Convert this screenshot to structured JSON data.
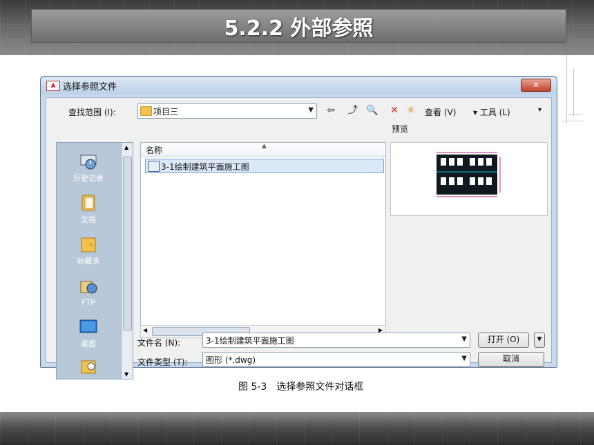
{
  "slide": {
    "title": "5.2.2 外部参照",
    "caption": "图 5-3　选择参照文件对话框"
  },
  "dialog": {
    "title": "选择参照文件",
    "app_icon_text": "A",
    "close_label": "✕",
    "look_in_label": "查找范围 (I):",
    "look_in_value": "项目三",
    "toolbar": {
      "back_icon": "⇦",
      "up_folder_icon": "⤴",
      "search_icon": "🔍",
      "delete_icon": "✕",
      "new_folder_icon": "✳",
      "views_label": "查看 (V)",
      "tools_label": "▾ 工具 (L)",
      "tools_arrow": "▾"
    },
    "places": [
      {
        "label": "历史记录",
        "icon": "history-icon"
      },
      {
        "label": "文档",
        "icon": "documents-icon"
      },
      {
        "label": "收藏夹",
        "icon": "favorites-icon"
      },
      {
        "label": "FTP",
        "icon": "ftp-icon"
      },
      {
        "label": "桌面",
        "icon": "desktop-icon"
      }
    ],
    "file_list": {
      "column_name": "名称",
      "files": [
        "3-1绘制建筑平面施工图"
      ]
    },
    "preview_label": "预览",
    "filename_label": "文件名 (N):",
    "filename_value": "3-1绘制建筑平面施工图",
    "filetype_label": "文件类型 (T):",
    "filetype_value": "图形 (*.dwg)",
    "open_label": "打开 (O)",
    "cancel_label": "取消",
    "colors": {
      "selection": "#dbe8f8",
      "close_button": "#c4432e",
      "places_bg": "#b9c8d9"
    }
  }
}
